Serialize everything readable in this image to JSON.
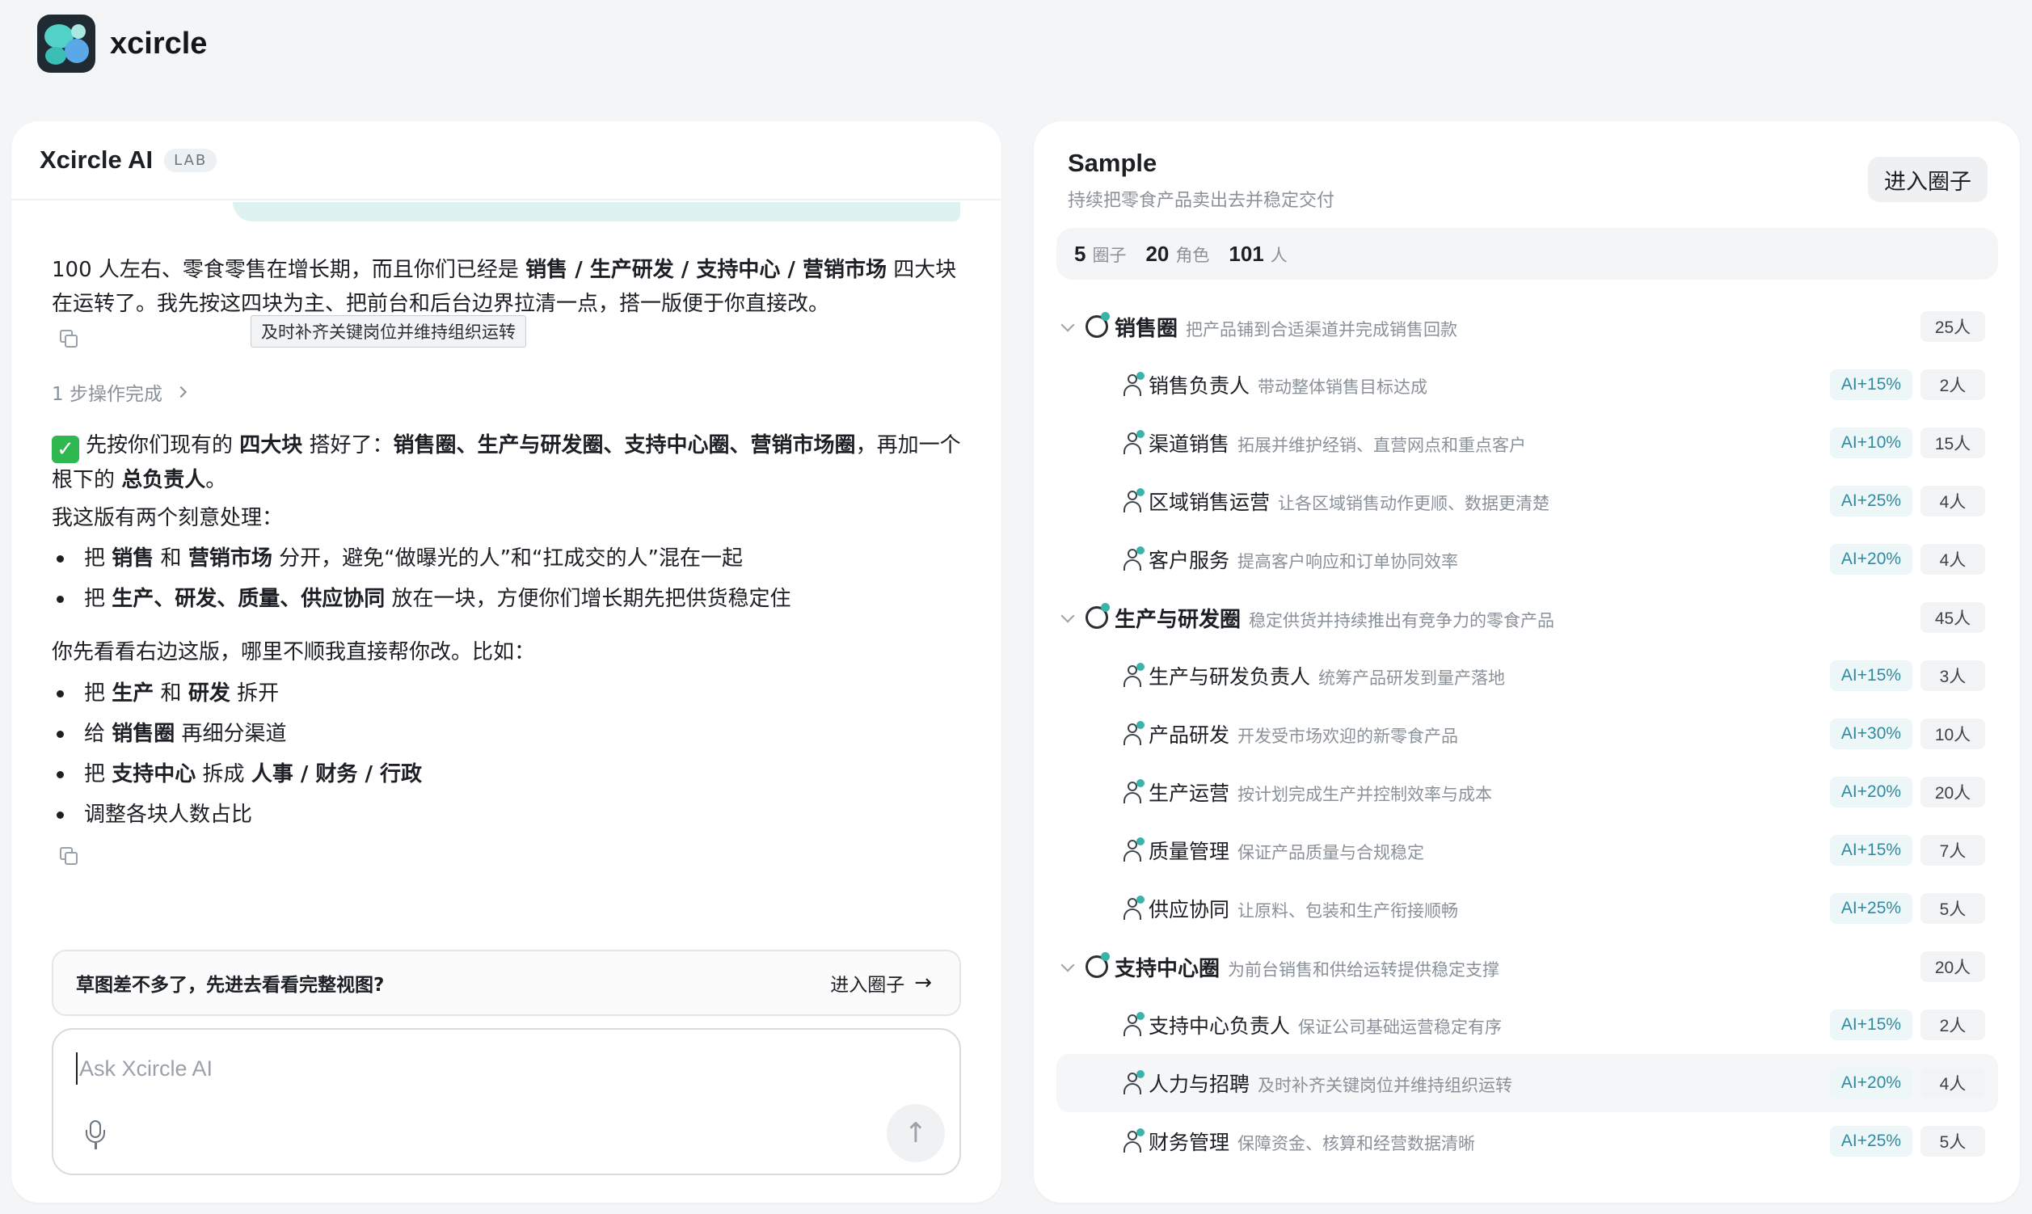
{
  "app": {
    "brand": "xcircle"
  },
  "chat": {
    "title": "Xcircle AI",
    "lab": "LAB",
    "msg1_a": "100 人左右、零食零售在增长期，而且你们已经是 ",
    "msg1_b": "销售 / 生产研发 / 支持中心 / 营销市场",
    "msg1_c": " 四大块在运转了。我先按这四块为主、把前台和后台边界拉清一点，搭一版便于你直接改。",
    "tooltip": "及时补齐关键岗位并维持组织运转",
    "steps": "1 步操作完成",
    "msg2": {
      "a": "先按你们现有的 ",
      "b": "四大块",
      "c": " 搭好了：",
      "d": "销售圈、生产与研发圈、支持中心圈、营销市场圈",
      "e": "，再加一个根下的 ",
      "f": "总负责人",
      "g": "。"
    },
    "intro": "我这版有两个刻意处理：",
    "bullets1": [
      {
        "a": "把 ",
        "b": "销售",
        "c": " 和 ",
        "d": "营销市场",
        "e": " 分开，避免“做曝光的人”和“扛成交的人”混在一起"
      },
      {
        "a": "把 ",
        "b": "生产、研发、质量、供应协同",
        "c": " 放在一块，方便你们增长期先把供货稳定住"
      }
    ],
    "ask": "你先看看右边这版，哪里不顺我直接帮你改。比如：",
    "bullets2": [
      {
        "a": "把 ",
        "b": "生产",
        "c": " 和 ",
        "d": "研发",
        "e": " 拆开"
      },
      {
        "a": "给 ",
        "b": "销售圈",
        "c": " 再细分渠道"
      },
      {
        "a": "把 ",
        "b": "支持中心",
        "c": " 拆成 ",
        "d": "人事 / 财务 / 行政"
      },
      {
        "a": "调整各块人数占比"
      }
    ],
    "suggest_q": "草图差不多了，先进去看看完整视图?",
    "suggest_go": "进入圈子",
    "input_placeholder": "Ask Xcircle AI"
  },
  "sample": {
    "title": "Sample",
    "subtitle": "持续把零食产品卖出去并稳定交付",
    "enter": "进入圈子",
    "stats": [
      {
        "num": "5",
        "label": "圈子"
      },
      {
        "num": "20",
        "label": "角色"
      },
      {
        "num": "101",
        "label": "人"
      }
    ],
    "groups": [
      {
        "name": "销售圈",
        "desc": "把产品铺到合适渠道并完成销售回款",
        "count": "25人",
        "roles": [
          {
            "name": "销售负责人",
            "desc": "带动整体销售目标达成",
            "ai": "AI+15%",
            "count": "2人"
          },
          {
            "name": "渠道销售",
            "desc": "拓展并维护经销、直营网点和重点客户",
            "ai": "AI+10%",
            "count": "15人"
          },
          {
            "name": "区域销售运营",
            "desc": "让各区域销售动作更顺、数据更清楚",
            "ai": "AI+25%",
            "count": "4人"
          },
          {
            "name": "客户服务",
            "desc": "提高客户响应和订单协同效率",
            "ai": "AI+20%",
            "count": "4人"
          }
        ]
      },
      {
        "name": "生产与研发圈",
        "desc": "稳定供货并持续推出有竞争力的零食产品",
        "count": "45人",
        "roles": [
          {
            "name": "生产与研发负责人",
            "desc": "统筹产品研发到量产落地",
            "ai": "AI+15%",
            "count": "3人"
          },
          {
            "name": "产品研发",
            "desc": "开发受市场欢迎的新零食产品",
            "ai": "AI+30%",
            "count": "10人"
          },
          {
            "name": "生产运营",
            "desc": "按计划完成生产并控制效率与成本",
            "ai": "AI+20%",
            "count": "20人"
          },
          {
            "name": "质量管理",
            "desc": "保证产品质量与合规稳定",
            "ai": "AI+15%",
            "count": "7人"
          },
          {
            "name": "供应协同",
            "desc": "让原料、包装和生产衔接顺畅",
            "ai": "AI+25%",
            "count": "5人"
          }
        ]
      },
      {
        "name": "支持中心圈",
        "desc": "为前台销售和供给运转提供稳定支撑",
        "count": "20人",
        "roles": [
          {
            "name": "支持中心负责人",
            "desc": "保证公司基础运营稳定有序",
            "ai": "AI+15%",
            "count": "2人"
          },
          {
            "name": "人力与招聘",
            "desc": "及时补齐关键岗位并维持组织运转",
            "ai": "AI+20%",
            "count": "4人"
          },
          {
            "name": "财务管理",
            "desc": "保障资金、核算和经营数据清晰",
            "ai": "AI+25%",
            "count": "5人"
          }
        ]
      }
    ]
  }
}
